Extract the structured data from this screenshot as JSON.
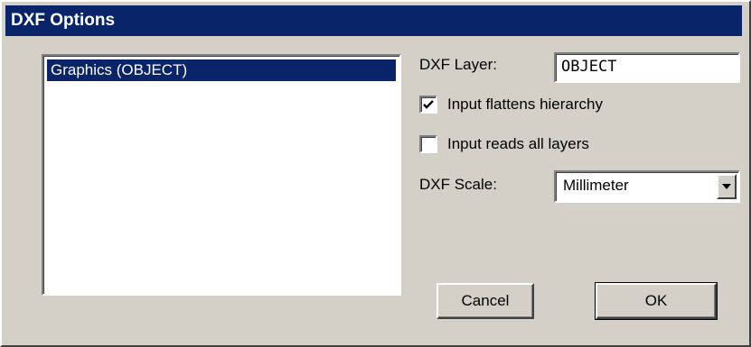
{
  "window": {
    "title": "DXF Options"
  },
  "layers_list": {
    "items": [
      "Graphics (OBJECT)"
    ],
    "selected_index": 0
  },
  "dxf_layer": {
    "label": "DXF Layer:",
    "value": "OBJECT"
  },
  "options": {
    "flatten_hierarchy": {
      "label": "Input flattens hierarchy",
      "checked": true
    },
    "read_all_layers": {
      "label": "Input reads all layers",
      "checked": false
    }
  },
  "dxf_scale": {
    "label": "DXF Scale:",
    "value": "Millimeter"
  },
  "buttons": {
    "cancel": "Cancel",
    "ok": "OK"
  },
  "colors": {
    "title_bar": "#0a246a",
    "face": "#d4d0c8",
    "selection": "#0a246a"
  }
}
